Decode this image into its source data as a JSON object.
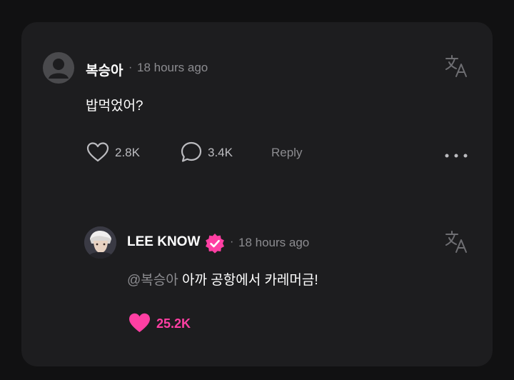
{
  "comment": {
    "username": "복승아",
    "separator": "·",
    "time": "18 hours ago",
    "text": "밥먹었어?",
    "likes": "2.8K",
    "replies": "3.4K",
    "reply_label": "Reply"
  },
  "reply": {
    "username": "LEE KNOW",
    "separator": "·",
    "time": "18 hours ago",
    "mention": "@복승아",
    "text": " 아까 공항에서 카레머금!",
    "likes": "25.2K"
  },
  "colors": {
    "accent": "#ff3fa3",
    "muted": "#8c8c90",
    "card": "#1d1d1f"
  }
}
